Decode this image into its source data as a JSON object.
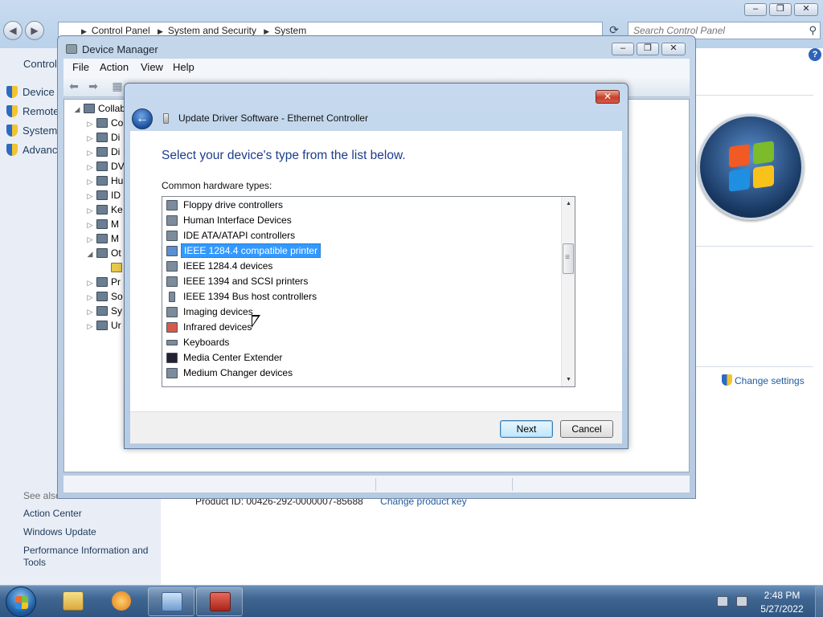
{
  "control_panel": {
    "breadcrumb": [
      "Control Panel",
      "System and Security",
      "System"
    ],
    "search_placeholder": "Search Control Panel",
    "window_controls": [
      "–",
      "❐",
      "✕"
    ],
    "sidebar_home": "Control",
    "sidebar_links": [
      "Device M",
      "Remote",
      "System",
      "Advance"
    ],
    "see_also_title": "See also",
    "see_also_links": [
      "Action Center",
      "Windows Update",
      "Performance Information and Tools"
    ],
    "change_settings": "Change settings",
    "product_id": "Product ID: 00426-292-0000007-85688",
    "change_product_key": "Change product key"
  },
  "device_manager": {
    "title": "Device Manager",
    "menu": [
      "File",
      "Action",
      "View",
      "Help"
    ],
    "window_controls": [
      "–",
      "❐",
      "✕"
    ],
    "tree": [
      {
        "label": "Collab",
        "exp": "◢"
      },
      {
        "label": "Co",
        "exp": "▷"
      },
      {
        "label": "Di",
        "exp": "▷"
      },
      {
        "label": "Di",
        "exp": "▷"
      },
      {
        "label": "DV",
        "exp": "▷"
      },
      {
        "label": "Hu",
        "exp": "▷"
      },
      {
        "label": "ID",
        "exp": "▷"
      },
      {
        "label": "Ke",
        "exp": "▷"
      },
      {
        "label": "M",
        "exp": "▷"
      },
      {
        "label": "M",
        "exp": "▷"
      },
      {
        "label": "Ot",
        "exp": "◢"
      },
      {
        "label": "",
        "exp": ""
      },
      {
        "label": "Pr",
        "exp": "▷"
      },
      {
        "label": "So",
        "exp": "▷"
      },
      {
        "label": "Sy",
        "exp": "▷"
      },
      {
        "label": "Ur",
        "exp": "▷"
      }
    ]
  },
  "update_driver": {
    "window_title": "Update Driver Software - Ethernet Controller",
    "close_label": "✕",
    "back_label": "←",
    "heading": "Select your device's type from the list below.",
    "list_label": "Common hardware types:",
    "items": [
      {
        "label": "Floppy drive controllers",
        "selected": false
      },
      {
        "label": "Human Interface Devices",
        "selected": false
      },
      {
        "label": "IDE ATA/ATAPI controllers",
        "selected": false
      },
      {
        "label": "IEEE 1284.4 compatible printer",
        "selected": true
      },
      {
        "label": "IEEE 1284.4 devices",
        "selected": false
      },
      {
        "label": "IEEE 1394 and SCSI printers",
        "selected": false
      },
      {
        "label": "IEEE 1394 Bus host controllers",
        "selected": false
      },
      {
        "label": "Imaging devices",
        "selected": false
      },
      {
        "label": "Infrared devices",
        "selected": false
      },
      {
        "label": "Keyboards",
        "selected": false
      },
      {
        "label": "Media Center Extender",
        "selected": false
      },
      {
        "label": "Medium Changer devices",
        "selected": false
      }
    ],
    "next_label": "Next",
    "cancel_label": "Cancel"
  },
  "taskbar": {
    "time": "2:48 PM",
    "date": "5/27/2022"
  },
  "colors": {
    "heading_blue": "#1e3d8a",
    "selection_blue": "#3399ff",
    "link_blue": "#1e5a9e"
  }
}
